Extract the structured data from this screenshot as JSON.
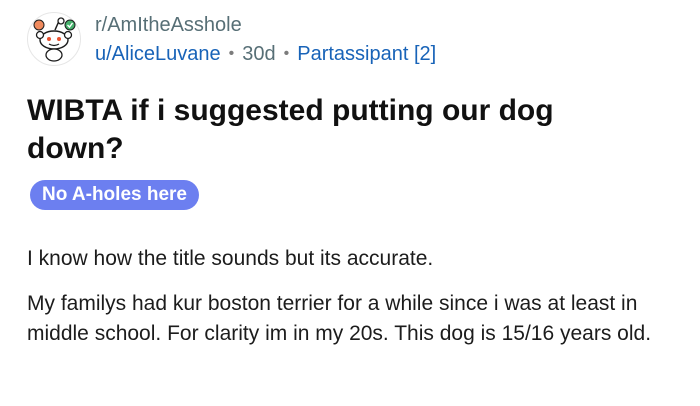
{
  "post": {
    "subreddit": "r/AmItheAsshole",
    "username": "u/AliceLuvane",
    "age": "30d",
    "user_flair": "Partassipant [2]",
    "title": "WIBTA if i suggested putting our dog down?",
    "flair": "No A-holes here",
    "paragraphs": [
      "I know how the title sounds but its accurate.",
      "My familys had kur boston terrier for a while since i was at least in middle school. For clarity im in my 20s. This dog is 15/16 years old."
    ],
    "avatar_icon": "reddit-snoo-avatar-icon"
  },
  "colors": {
    "meta_gray": "#576f76",
    "link_blue": "#1863b8",
    "flair_bg": "#6c7ff0",
    "flair_text": "#ffffff",
    "title_text": "#111111"
  }
}
